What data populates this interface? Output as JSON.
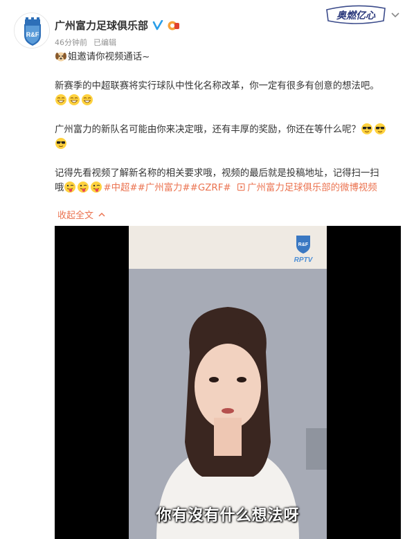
{
  "post": {
    "account_name": "广州富力足球俱乐部",
    "time_ago": "46分钟前",
    "edited": "已编辑",
    "brand_badge": "奥燃亿心",
    "lines": {
      "l1": "姐邀请你视频通话~",
      "l2": "新赛季的中超联赛将实行球队中性化名称改革，你一定有很多有创意的想法吧。",
      "l3": "广州富力的新队名可能由你来决定哦，还有丰厚的奖励，你还在等什么呢？",
      "l4": "记得先看视频了解新名称的相关要求哦，视频的最后就是投稿地址，记得扫一扫",
      "l5_start": "哦"
    },
    "hashtags": [
      "#中超#",
      "#广州富力#",
      "#GZRF#"
    ],
    "video_link": "广州富力足球俱乐部的微博视频",
    "collapse_label": "收起全文"
  },
  "video": {
    "logo_text": "RPTV",
    "subtitle": "你有沒有什么想法呀"
  },
  "colors": {
    "link": "#eb7350",
    "verified": "#2a9ee8",
    "text": "#333333",
    "meta": "#939393"
  },
  "icons": [
    "club-crest-icon",
    "verified-icon",
    "member-icon",
    "chevron-down-icon",
    "video-link-icon",
    "collapse-arrow-icon"
  ]
}
